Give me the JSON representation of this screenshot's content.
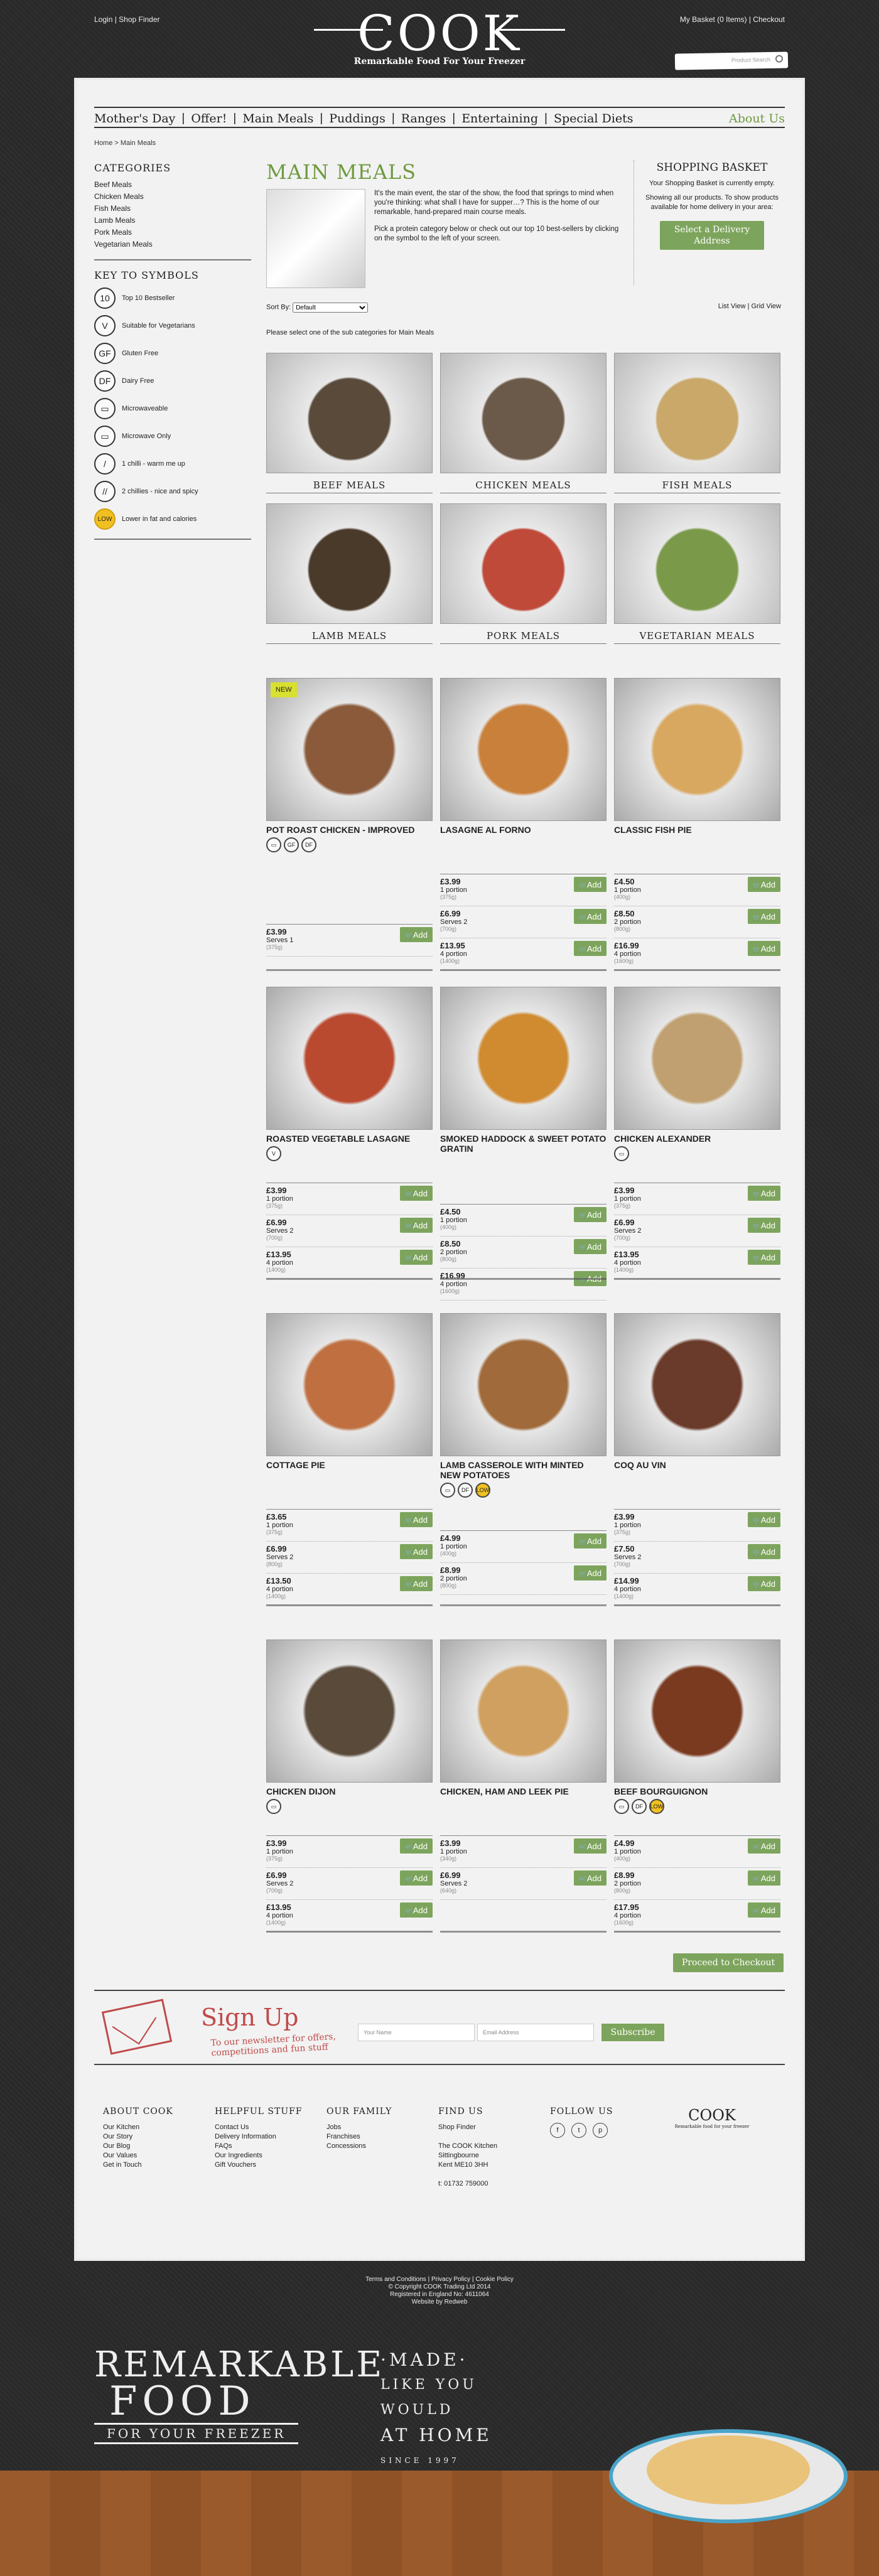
{
  "topbar": {
    "left": "Login | Shop Finder",
    "right": "My Basket (0 Items) | Checkout"
  },
  "logo": {
    "title": "COOK",
    "tagline": "Remarkable Food For Your Freezer"
  },
  "search": {
    "placeholder": "Product Search"
  },
  "nav": {
    "items": [
      "Mother's Day",
      "Offer!",
      "Main Meals",
      "Puddings",
      "Ranges",
      "Entertaining",
      "Special Diets"
    ],
    "about": "About Us"
  },
  "breadcrumb": "Home >   Main Meals",
  "sidebar": {
    "categories_title": "CATEGORIES",
    "categories": [
      "Beef Meals",
      "Chicken Meals",
      "Fish Meals",
      "Lamb Meals",
      "Pork Meals",
      "Vegetarian Meals"
    ],
    "symbols_title": "KEY TO SYMBOLS",
    "symbols": [
      {
        "icon": "10",
        "label": "Top 10 Bestseller"
      },
      {
        "icon": "V",
        "label": "Suitable for Vegetarians"
      },
      {
        "icon": "GF",
        "label": "Gluten Free"
      },
      {
        "icon": "DF",
        "label": "Dairy Free"
      },
      {
        "icon": "▭",
        "label": "Microwaveable"
      },
      {
        "icon": "▭",
        "label": "Microwave Only"
      },
      {
        "icon": "/",
        "label": "1 chilli - warm me up"
      },
      {
        "icon": "//",
        "label": "2 chillies - nice and spicy"
      },
      {
        "icon": "LOW",
        "label": "Lower in fat and calories"
      }
    ]
  },
  "main": {
    "title": "MAIN MEALS",
    "intro1": "It's the main event, the star of the show, the food that springs to mind when you're thinking: what shall I have for supper…? This is the home of our remarkable, hand-prepared main course meals.",
    "intro2": "Pick a protein category below or check out our top 10 best-sellers by clicking on the symbol to the left of your screen.",
    "sort_label": "Sort By:",
    "sort_value": "Default",
    "view": "List View  |  Grid View",
    "prompt": "Please select one of the sub categories for Main Meals"
  },
  "basket": {
    "title": "SHOPPING BASKET",
    "empty": "Your Shopping Basket is currently empty.",
    "info": "Showing all our products. To show products available for home delivery in your area:",
    "button": "Select a Delivery Address"
  },
  "categories": [
    "BEEF MEALS",
    "CHICKEN MEALS",
    "FISH MEALS",
    "LAMB MEALS",
    "PORK MEALS",
    "VEGETARIAN MEALS"
  ],
  "products": [
    {
      "name": "POT ROAST CHICKEN - IMPROVED",
      "badges": [
        "▭",
        "GF",
        "DF"
      ],
      "new": "NEW",
      "prices": [
        {
          "p": "£3.99",
          "d": "Serves 1",
          "g": "(375g)"
        }
      ]
    },
    {
      "name": "LASAGNE AL FORNO",
      "badges": [],
      "prices": [
        {
          "p": "£3.99",
          "d": "1 portion",
          "g": "(375g)"
        },
        {
          "p": "£6.99",
          "d": "Serves 2",
          "g": "(700g)"
        },
        {
          "p": "£13.95",
          "d": "4 portion",
          "g": "(1400g)"
        }
      ]
    },
    {
      "name": "CLASSIC FISH PIE",
      "badges": [],
      "prices": [
        {
          "p": "£4.50",
          "d": "1 portion",
          "g": "(400g)"
        },
        {
          "p": "£8.50",
          "d": "2 portion",
          "g": "(800g)"
        },
        {
          "p": "£16.99",
          "d": "4 portion",
          "g": "(1600g)"
        }
      ]
    },
    {
      "name": "ROASTED VEGETABLE LASAGNE",
      "badges": [
        "V"
      ],
      "prices": [
        {
          "p": "£3.99",
          "d": "1 portion",
          "g": "(375g)"
        },
        {
          "p": "£6.99",
          "d": "Serves 2",
          "g": "(700g)"
        },
        {
          "p": "£13.95",
          "d": "4 portion",
          "g": "(1400g)"
        }
      ]
    },
    {
      "name": "SMOKED HADDOCK & SWEET POTATO GRATIN",
      "badges": [],
      "prices": [
        {
          "p": "£4.50",
          "d": "1 portion",
          "g": "(400g)"
        },
        {
          "p": "£8.50",
          "d": "2 portion",
          "g": "(800g)"
        },
        {
          "p": "£16.99",
          "d": "4 portion",
          "g": "(1600g)"
        }
      ]
    },
    {
      "name": "CHICKEN ALEXANDER",
      "badges": [
        "▭"
      ],
      "prices": [
        {
          "p": "£3.99",
          "d": "1 portion",
          "g": "(375g)"
        },
        {
          "p": "£6.99",
          "d": "Serves 2",
          "g": "(700g)"
        },
        {
          "p": "£13.95",
          "d": "4 portion",
          "g": "(1400g)"
        }
      ]
    },
    {
      "name": "COTTAGE PIE",
      "badges": [],
      "prices": [
        {
          "p": "£3.65",
          "d": "1 portion",
          "g": "(375g)"
        },
        {
          "p": "£6.99",
          "d": "Serves 2",
          "g": "(800g)"
        },
        {
          "p": "£13.50",
          "d": "4 portion",
          "g": "(1400g)"
        }
      ]
    },
    {
      "name": "LAMB CASSEROLE WITH MINTED NEW POTATOES",
      "badges": [
        "▭",
        "DF",
        "LOW"
      ],
      "prices": [
        {
          "p": "£4.99",
          "d": "1 portion",
          "g": "(400g)"
        },
        {
          "p": "£8.99",
          "d": "2 portion",
          "g": "(800g)"
        }
      ]
    },
    {
      "name": "COQ AU VIN",
      "badges": [],
      "prices": [
        {
          "p": "£3.99",
          "d": "1 portion",
          "g": "(375g)"
        },
        {
          "p": "£7.50",
          "d": "Serves 2",
          "g": "(700g)"
        },
        {
          "p": "£14.99",
          "d": "4 portion",
          "g": "(1400g)"
        }
      ]
    },
    {
      "name": "CHICKEN DIJON",
      "badges": [
        "▭"
      ],
      "prices": [
        {
          "p": "£3.99",
          "d": "1 portion",
          "g": "(375g)"
        },
        {
          "p": "£6.99",
          "d": "Serves 2",
          "g": "(700g)"
        },
        {
          "p": "£13.95",
          "d": "4 portion",
          "g": "(1400g)"
        }
      ]
    },
    {
      "name": "CHICKEN, HAM AND LEEK PIE",
      "badges": [],
      "prices": [
        {
          "p": "£3.99",
          "d": "1 portion",
          "g": "(340g)"
        },
        {
          "p": "£6.99",
          "d": "Serves 2",
          "g": "(640g)"
        }
      ]
    },
    {
      "name": "BEEF BOURGUIGNON",
      "badges": [
        "▭",
        "DF",
        "LOW"
      ],
      "prices": [
        {
          "p": "£4.99",
          "d": "1 portion",
          "g": "(400g)"
        },
        {
          "p": "£8.99",
          "d": "2 portion",
          "g": "(800g)"
        },
        {
          "p": "£17.95",
          "d": "4 portion",
          "g": "(1600g)"
        }
      ]
    }
  ],
  "add_label": "Add",
  "checkout": "Proceed to Checkout",
  "signup": {
    "title": "Sign Up",
    "sub": "To our newsletter for offers, competitions and fun stuff",
    "name": "Your Name",
    "email": "Email Address",
    "button": "Subscribe"
  },
  "footer": {
    "cols": [
      {
        "title": "ABOUT COOK",
        "links": [
          "Our Kitchen",
          "Our Story",
          "Our Blog",
          "Our Values",
          "Get in Touch"
        ]
      },
      {
        "title": "HELPFUL STUFF",
        "links": [
          "Contact Us",
          "Delivery Information",
          "FAQs",
          "Our Ingredients",
          "Gift Vouchers"
        ]
      },
      {
        "title": "OUR FAMILY",
        "links": [
          "Jobs",
          "Franchises",
          "Concessions"
        ]
      },
      {
        "title": "FIND US",
        "links": [
          "Shop Finder",
          "",
          "The COOK Kitchen",
          "Sittingbourne",
          "Kent ME10 3HH",
          "",
          "t: 01732 759000"
        ]
      },
      {
        "title": "FOLLOW US",
        "links": []
      }
    ],
    "social": [
      "f",
      "t",
      "p"
    ],
    "logo": "COOK",
    "logo_sub": "Remarkable food for your freezer"
  },
  "legal": [
    "Terms and Conditions | Privacy Policy | Cookie Policy",
    "© Copyright COOK Trading Ltd 2014",
    "Registered in England No: 4611064",
    "Website by Redweb"
  ],
  "bottom": {
    "r1": "REMARKABLE",
    "r2": "FOOD",
    "r3": "FOR YOUR FREEZER",
    "m1": "·MADE·",
    "m2": "LIKE YOU WOULD",
    "m3": "AT HOME",
    "since": "SINCE 1997"
  },
  "colors": {
    "accent": "#6e9a3f",
    "button": "#7da45c",
    "signup": "#c04a4a"
  }
}
